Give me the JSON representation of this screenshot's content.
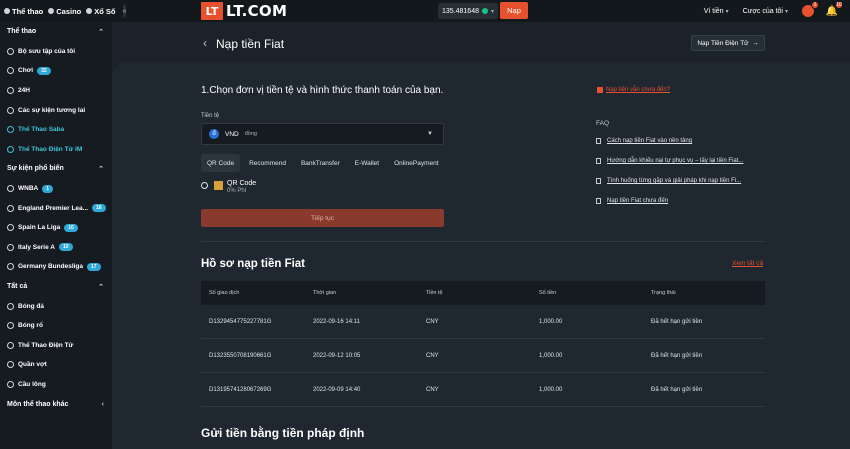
{
  "topbar": {
    "nav": [
      {
        "label": "Thể thao",
        "icon": "sports-icon"
      },
      {
        "label": "Casino",
        "icon": "casino-icon"
      },
      {
        "label": "Xổ Số",
        "icon": "lottery-icon"
      }
    ],
    "collapse_icon": "«",
    "logo_box": "LT",
    "logo_text": "LT.COM",
    "balance": "135.481648",
    "deposit_label": "Nạp",
    "wallet_label": "Ví tiền",
    "account_label": "Cược của tôi",
    "avatar_badge": "1",
    "bell_badge": "10"
  },
  "sidebar": {
    "sections": [
      {
        "title": "Thể thao",
        "items": [
          {
            "label": "Bộ sưu tập của tôi",
            "icon": "star-icon",
            "count": ""
          },
          {
            "label": "Chơi",
            "icon": "live-icon",
            "count": "32"
          },
          {
            "label": "24H",
            "icon": "clock-icon",
            "count": ""
          },
          {
            "label": "Các sự kiện tương lai",
            "icon": "calendar-icon",
            "count": ""
          },
          {
            "label": "Thể Thao Saba",
            "icon": "saba-icon",
            "count": "",
            "highlight": true
          },
          {
            "label": "Thể Thao Điện Tử IM",
            "icon": "esports-icon",
            "count": "",
            "highlight": true
          }
        ]
      },
      {
        "title": "Sự kiện phổ biến",
        "items": [
          {
            "label": "WNBA",
            "icon": "basketball-icon",
            "count": "1"
          },
          {
            "label": "England Premier Lea...",
            "icon": "soccer-icon",
            "count": "16"
          },
          {
            "label": "Spain La Liga",
            "icon": "soccer-icon",
            "count": "10"
          },
          {
            "label": "Italy Serie A",
            "icon": "soccer-icon",
            "count": "10"
          },
          {
            "label": "Germany Bundesliga",
            "icon": "soccer-icon",
            "count": "17"
          }
        ]
      },
      {
        "title": "Tất cả",
        "items": [
          {
            "label": "Bóng đá",
            "icon": "soccer-icon",
            "count": ""
          },
          {
            "label": "Bóng rổ",
            "icon": "basketball-icon",
            "count": ""
          },
          {
            "label": "Thể Thao Điện Tử",
            "icon": "esports-icon",
            "count": ""
          },
          {
            "label": "Quần vợt",
            "icon": "tennis-icon",
            "count": ""
          },
          {
            "label": "Cầu lông",
            "icon": "badminton-icon",
            "count": ""
          }
        ]
      }
    ],
    "more_label": "Môn thể thao khác"
  },
  "main": {
    "back_icon": "‹",
    "title": "Nạp tiền Fiat",
    "crypto_button": "Nạp Tiền Điện Tử",
    "step_title": "1.Chọn đơn vị tiền tệ và hình thức thanh toán của bạn.",
    "currency_label": "Tiền tệ",
    "currency_code": "VND",
    "currency_unit": "đồng",
    "currency_icon": "đ",
    "method_tabs": [
      "QR Code",
      "Recommend",
      "BankTransfer",
      "E-Wallet",
      "OnlinePayment"
    ],
    "method_name": "QR Code",
    "method_fee": "0% Phí",
    "continue_label": "Tiếp tục",
    "not_received": "Nạp tiền vẫn chưa đến?",
    "faq_label": "FAQ",
    "faq_items": [
      "Cách nạp tiền Fiat vào nền tảng",
      "Hướng dẫn khiếu nại tự phục vụ – lấy lại tiền Fiat...",
      "Tình huống từng gặp và giải pháp khi nạp tiền Fi...",
      "Nạp tiền Fiat chưa đến"
    ],
    "history_title": "Hồ sơ nạp tiền Fiat",
    "view_all": "Xem tất cả",
    "table_headers": [
      "Số giao dịch",
      "Thời gian",
      "Tiền tệ",
      "Số tiền",
      "Trạng thái"
    ],
    "table_rows": [
      [
        "D1329454775227781G",
        "2022-09-16 14:11",
        "CNY",
        "1,000.00",
        "Đã hết hạn gửi tiền"
      ],
      [
        "D1323550708190661G",
        "2022-09-12 10:05",
        "CNY",
        "1,000.00",
        "Đã hết hạn gửi tiền"
      ],
      [
        "D1319574128067269G",
        "2022-09-09 14:40",
        "CNY",
        "1,000.00",
        "Đã hết hạn gửi tiền"
      ]
    ],
    "bottom_title": "Gửi tiền bằng tiền pháp định"
  },
  "colors": {
    "accent": "#e8512d",
    "highlight": "#3fc4d6",
    "background": "#1b2229"
  }
}
